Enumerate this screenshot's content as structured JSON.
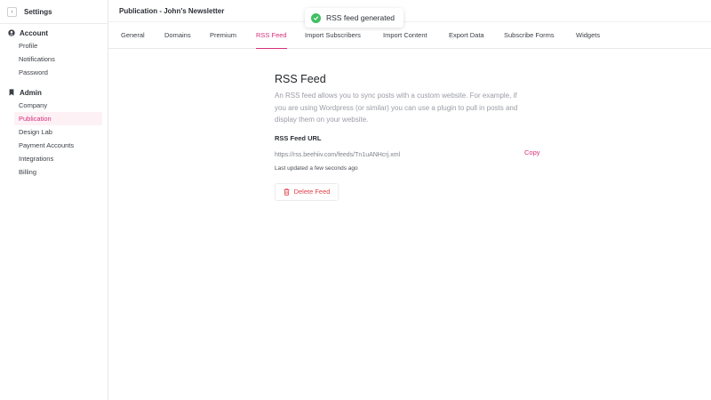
{
  "sidebar": {
    "title": "Settings",
    "sections": [
      {
        "label": "Account",
        "icon": "user-circle-icon",
        "items": [
          {
            "label": "Profile"
          },
          {
            "label": "Notifications"
          },
          {
            "label": "Password"
          }
        ]
      },
      {
        "label": "Admin",
        "icon": "bookmark-icon",
        "items": [
          {
            "label": "Company"
          },
          {
            "label": "Publication",
            "active": true
          },
          {
            "label": "Design Lab"
          },
          {
            "label": "Payment Accounts"
          },
          {
            "label": "Integrations"
          },
          {
            "label": "Billing"
          }
        ]
      }
    ]
  },
  "header": {
    "title": "Publication - John's Newsletter"
  },
  "tabs": [
    {
      "label": "General"
    },
    {
      "label": "Domains"
    },
    {
      "label": "Premium"
    },
    {
      "label": "RSS Feed",
      "active": true
    },
    {
      "label": "Import Subscribers"
    },
    {
      "label": "Import Content"
    },
    {
      "label": "Export Data"
    },
    {
      "label": "Subscribe Forms"
    },
    {
      "label": "Widgets"
    }
  ],
  "toast": {
    "message": "RSS feed generated",
    "icon": "check-circle-icon"
  },
  "main": {
    "title": "RSS Feed",
    "description": "An RSS feed allows you to sync posts with a custom website. For example, if you are using Wordpress (or similar) you can use a plugin to pull in posts and display them on your website.",
    "url_label": "RSS Feed URL",
    "url_value": "https://rss.beehiiv.com/feeds/Tn1uANHcrj.xml",
    "copy_label": "Copy",
    "updated": "Last updated a few seconds ago",
    "delete_label": "Delete Feed"
  },
  "colors": {
    "accent": "#d62f7c",
    "danger": "#e0424a",
    "success": "#3fbf62",
    "active_bg": "#fdf1f6"
  }
}
